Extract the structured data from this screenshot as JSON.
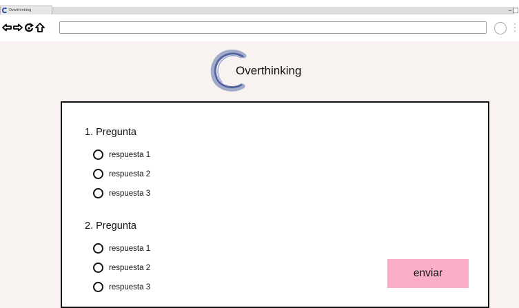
{
  "browser": {
    "tab": {
      "title": "Overthinking"
    },
    "window_controls": {
      "minimize": "–",
      "maximize": "□"
    },
    "address": {
      "value": ""
    }
  },
  "header": {
    "brand_name": "Overthinking"
  },
  "quiz": {
    "questions": [
      {
        "title": "1. Pregunta",
        "options": [
          "respuesta 1",
          "respuesta 2",
          "respuesta 3"
        ]
      },
      {
        "title": "2. Pregunta",
        "options": [
          "respuesta 1",
          "respuesta 2",
          "respuesta 3"
        ]
      }
    ],
    "submit_label": "enviar"
  },
  "colors": {
    "page_background": "#f8f3f1",
    "submit_button": "#fbaec8",
    "logo_swirl": "#5a6da8",
    "card_border": "#111111"
  }
}
